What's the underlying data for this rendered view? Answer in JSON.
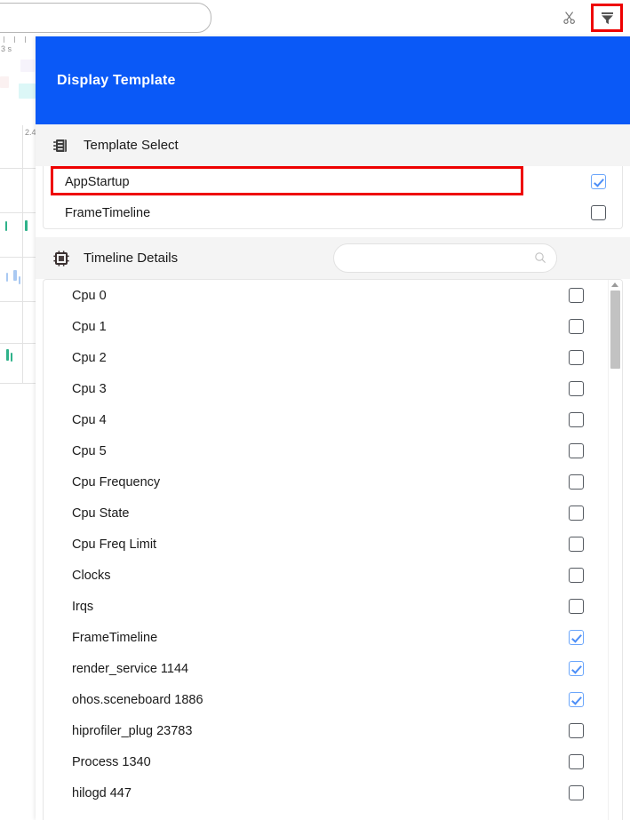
{
  "background": {
    "search_placeholder": "",
    "icons": {
      "scissors": "scissors-icon",
      "filter": "filter-icon"
    },
    "ruler": {
      "labels": [
        "3 s",
        "2.4"
      ]
    }
  },
  "modal": {
    "title": "Display Template",
    "accent_color": "#0a59f7",
    "highlight_color": "#ee0000",
    "template_select": {
      "title": "Template Select",
      "icon": "list-notebook-icon",
      "items": [
        {
          "label": "AppStartup",
          "checked": true,
          "highlighted": true
        },
        {
          "label": "FrameTimeline",
          "checked": false,
          "highlighted": false
        }
      ]
    },
    "timeline_details": {
      "title": "Timeline Details",
      "icon": "chip-icon",
      "search": {
        "value": "",
        "placeholder": "",
        "icon": "search-icon"
      },
      "items": [
        {
          "label": "Cpu 0",
          "checked": false
        },
        {
          "label": "Cpu 1",
          "checked": false
        },
        {
          "label": "Cpu 2",
          "checked": false
        },
        {
          "label": "Cpu 3",
          "checked": false
        },
        {
          "label": "Cpu 4",
          "checked": false
        },
        {
          "label": "Cpu 5",
          "checked": false
        },
        {
          "label": "Cpu Frequency",
          "checked": false
        },
        {
          "label": "Cpu State",
          "checked": false
        },
        {
          "label": "Cpu Freq Limit",
          "checked": false
        },
        {
          "label": "Clocks",
          "checked": false
        },
        {
          "label": "Irqs",
          "checked": false
        },
        {
          "label": "FrameTimeline",
          "checked": true
        },
        {
          "label": "render_service 1144",
          "checked": true
        },
        {
          "label": "ohos.sceneboard 1886",
          "checked": true
        },
        {
          "label": "hiprofiler_plug 23783",
          "checked": false
        },
        {
          "label": "Process 1340",
          "checked": false
        },
        {
          "label": "hilogd 447",
          "checked": false
        }
      ]
    }
  }
}
